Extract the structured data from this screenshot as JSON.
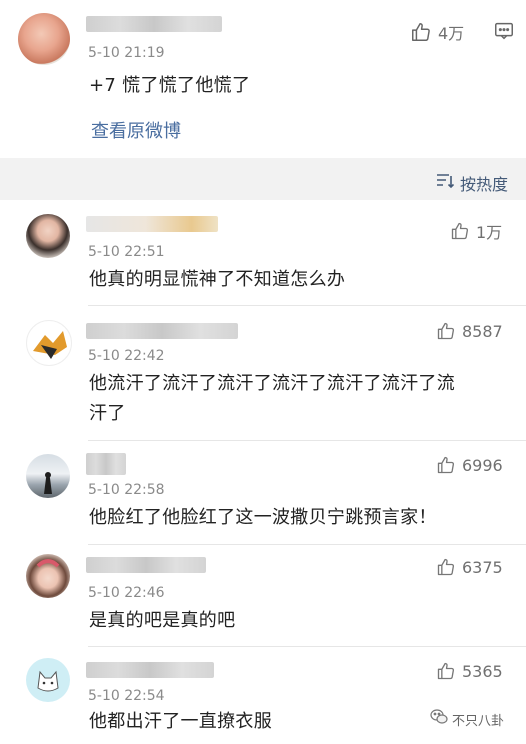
{
  "main_comment": {
    "time": "5-10 21:19",
    "text": "+7 慌了慌了他慌了",
    "likes": "4万",
    "view_original": "查看原微博"
  },
  "sort_label": "按热度",
  "replies": [
    {
      "time": "5-10 22:51",
      "likes": "1万",
      "text": "他真的明显慌神了不知道怎么办"
    },
    {
      "time": "5-10 22:42",
      "likes": "8587",
      "text_line1": "他流汗了流汗了流汗了流汗了流汗了流汗了流",
      "text_line2": "汗了"
    },
    {
      "time": "5-10 22:58",
      "likes": "6996",
      "text": "他脸红了他脸红了这一波撒贝宁跳预言家！"
    },
    {
      "time": "5-10 22:46",
      "likes": "6375",
      "text": "是真的吧是真的吧"
    },
    {
      "time": "5-10 22:54",
      "likes": "5365",
      "text": "他都出汗了一直撩衣服"
    }
  ],
  "watermark": "不只八卦",
  "icons": {
    "like": "thumbs-up-icon",
    "comment": "comment-icon",
    "sort": "sort-icon",
    "watermark": "wechat-icon"
  },
  "colors": {
    "link": "#4a6ea0",
    "background": "#f2f2f2"
  }
}
